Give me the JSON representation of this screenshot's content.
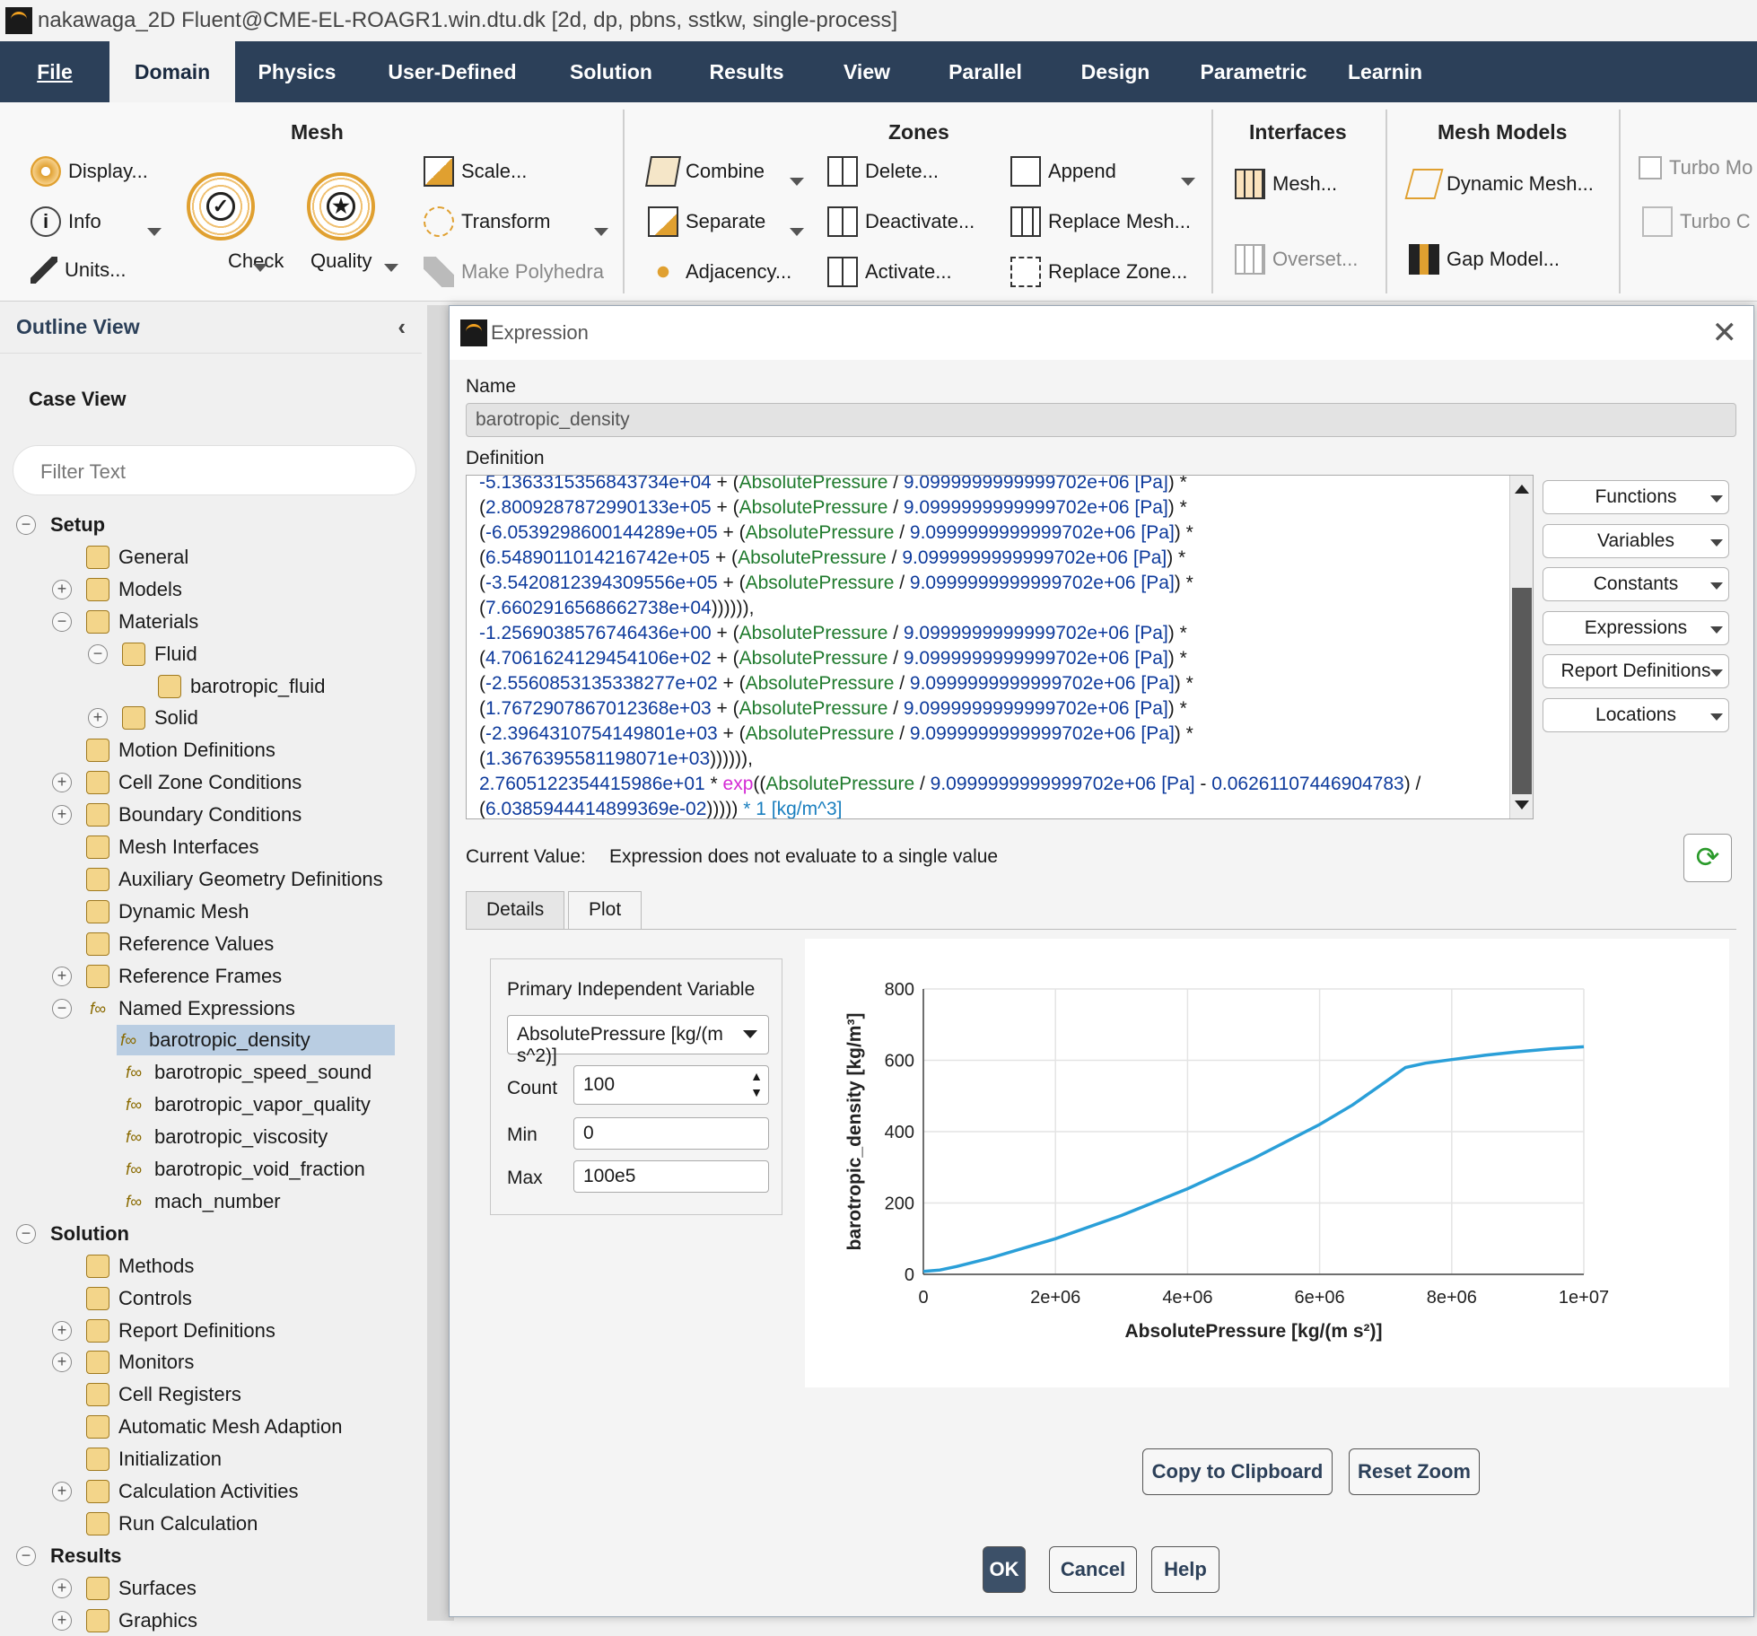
{
  "titlebar": {
    "title": "nakawaga_2D Fluent@CME-EL-ROAGR1.win.dtu.dk  [2d, dp, pbns, sstkw, single-process]"
  },
  "menu": [
    "File",
    "Domain",
    "Physics",
    "User-Defined",
    "Solution",
    "Results",
    "View",
    "Parallel",
    "Design",
    "Parametric",
    "Learnin"
  ],
  "ribbon": {
    "mesh": {
      "title": "Mesh",
      "display": "Display...",
      "info": "Info",
      "units": "Units...",
      "check": "Check",
      "quality": "Quality",
      "scale": "Scale...",
      "transform": "Transform",
      "make_polyhedra": "Make Polyhedra"
    },
    "zones": {
      "title": "Zones",
      "combine": "Combine",
      "separate": "Separate",
      "adjacency": "Adjacency...",
      "delete": "Delete...",
      "deactivate": "Deactivate...",
      "activate": "Activate...",
      "append": "Append",
      "replace_mesh": "Replace Mesh...",
      "replace_zone": "Replace Zone..."
    },
    "interfaces": {
      "title": "Interfaces",
      "mesh": "Mesh...",
      "overset": "Overset..."
    },
    "mesh_models": {
      "title": "Mesh Models",
      "dynamic_mesh": "Dynamic Mesh...",
      "gap_model": "Gap Model..."
    },
    "turbo": {
      "turbo_model": "Turbo Mo",
      "turbo_c": "Turbo C"
    }
  },
  "outline": {
    "title": "Outline View",
    "case_view": "Case View",
    "filter_placeholder": "Filter Text"
  },
  "tree": [
    {
      "label": "Setup",
      "bold": true,
      "pm": "−",
      "indent": 0
    },
    {
      "label": "General",
      "indent": 2
    },
    {
      "label": "Models",
      "pm": "+",
      "indent": 2
    },
    {
      "label": "Materials",
      "pm": "−",
      "indent": 2
    },
    {
      "label": "Fluid",
      "pm": "−",
      "indent": 3
    },
    {
      "label": "barotropic_fluid",
      "indent": 4
    },
    {
      "label": "Solid",
      "pm": "+",
      "indent": 3
    },
    {
      "label": "Motion Definitions",
      "indent": 2
    },
    {
      "label": "Cell Zone Conditions",
      "pm": "+",
      "indent": 2
    },
    {
      "label": "Boundary Conditions",
      "pm": "+",
      "indent": 2
    },
    {
      "label": "Mesh Interfaces",
      "indent": 2
    },
    {
      "label": "Auxiliary Geometry Definitions",
      "indent": 2
    },
    {
      "label": "Dynamic Mesh",
      "indent": 2
    },
    {
      "label": "Reference Values",
      "indent": 2
    },
    {
      "label": "Reference Frames",
      "pm": "+",
      "indent": 2
    },
    {
      "label": "Named Expressions",
      "pm": "−",
      "indent": 2
    },
    {
      "label": "barotropic_density",
      "indent": 3,
      "selected": true
    },
    {
      "label": "barotropic_speed_sound",
      "indent": 3
    },
    {
      "label": "barotropic_vapor_quality",
      "indent": 3
    },
    {
      "label": "barotropic_viscosity",
      "indent": 3
    },
    {
      "label": "barotropic_void_fraction",
      "indent": 3
    },
    {
      "label": "mach_number",
      "indent": 3
    },
    {
      "label": "Solution",
      "bold": true,
      "pm": "−",
      "indent": 0
    },
    {
      "label": "Methods",
      "indent": 2
    },
    {
      "label": "Controls",
      "indent": 2
    },
    {
      "label": "Report Definitions",
      "pm": "+",
      "indent": 2
    },
    {
      "label": "Monitors",
      "pm": "+",
      "indent": 2
    },
    {
      "label": "Cell Registers",
      "indent": 2
    },
    {
      "label": "Automatic Mesh Adaption",
      "indent": 2
    },
    {
      "label": "Initialization",
      "indent": 2
    },
    {
      "label": "Calculation Activities",
      "pm": "+",
      "indent": 2
    },
    {
      "label": "Run Calculation",
      "indent": 2
    },
    {
      "label": "Results",
      "bold": true,
      "pm": "−",
      "indent": 0
    },
    {
      "label": "Surfaces",
      "pm": "+",
      "indent": 2
    },
    {
      "label": "Graphics",
      "pm": "+",
      "indent": 2
    }
  ],
  "dialog": {
    "title": "Expression",
    "name_label": "Name",
    "name_value": "barotropic_density",
    "definition_label": "Definition",
    "definition_lines": [
      [
        [
          "n",
          "-5.1363315356843734e+04"
        ],
        [
          "o",
          " + ("
        ],
        [
          "v",
          "AbsolutePressure"
        ],
        [
          "o",
          " / "
        ],
        [
          "n",
          "9.0999999999999702e+06 [Pa]"
        ],
        [
          "o",
          ") *"
        ]
      ],
      [
        [
          "o",
          "("
        ],
        [
          "n",
          "2.8009287872990133e+05"
        ],
        [
          "o",
          " + ("
        ],
        [
          "v",
          "AbsolutePressure"
        ],
        [
          "o",
          " / "
        ],
        [
          "n",
          "9.0999999999999702e+06 [Pa]"
        ],
        [
          "o",
          ") *"
        ]
      ],
      [
        [
          "o",
          "("
        ],
        [
          "n",
          "-6.0539298600144289e+05"
        ],
        [
          "o",
          " + ("
        ],
        [
          "v",
          "AbsolutePressure"
        ],
        [
          "o",
          " / "
        ],
        [
          "n",
          "9.0999999999999702e+06 [Pa]"
        ],
        [
          "o",
          ") *"
        ]
      ],
      [
        [
          "o",
          "("
        ],
        [
          "n",
          "6.5489011014216742e+05"
        ],
        [
          "o",
          " + ("
        ],
        [
          "v",
          "AbsolutePressure"
        ],
        [
          "o",
          " / "
        ],
        [
          "n",
          "9.0999999999999702e+06 [Pa]"
        ],
        [
          "o",
          ") *"
        ]
      ],
      [
        [
          "o",
          "("
        ],
        [
          "n",
          "-3.5420812394309556e+05"
        ],
        [
          "o",
          " + ("
        ],
        [
          "v",
          "AbsolutePressure"
        ],
        [
          "o",
          " / "
        ],
        [
          "n",
          "9.0999999999999702e+06 [Pa]"
        ],
        [
          "o",
          ") *"
        ]
      ],
      [
        [
          "o",
          "("
        ],
        [
          "n",
          "7.6602916568662738e+04"
        ],
        [
          "o",
          ")))))),"
        ]
      ],
      [
        [
          "n",
          "-1.2569038576746436e+00"
        ],
        [
          "o",
          " + ("
        ],
        [
          "v",
          "AbsolutePressure"
        ],
        [
          "o",
          " / "
        ],
        [
          "n",
          "9.0999999999999702e+06 [Pa]"
        ],
        [
          "o",
          ") *"
        ]
      ],
      [
        [
          "o",
          "("
        ],
        [
          "n",
          "4.7061624129454106e+02"
        ],
        [
          "o",
          " + ("
        ],
        [
          "v",
          "AbsolutePressure"
        ],
        [
          "o",
          " / "
        ],
        [
          "n",
          "9.0999999999999702e+06 [Pa]"
        ],
        [
          "o",
          ") *"
        ]
      ],
      [
        [
          "o",
          "("
        ],
        [
          "n",
          "-2.5560853135338277e+02"
        ],
        [
          "o",
          " + ("
        ],
        [
          "v",
          "AbsolutePressure"
        ],
        [
          "o",
          " / "
        ],
        [
          "n",
          "9.0999999999999702e+06 [Pa]"
        ],
        [
          "o",
          ") *"
        ]
      ],
      [
        [
          "o",
          "("
        ],
        [
          "n",
          "1.7672907867012368e+03"
        ],
        [
          "o",
          " + ("
        ],
        [
          "v",
          "AbsolutePressure"
        ],
        [
          "o",
          " / "
        ],
        [
          "n",
          "9.0999999999999702e+06 [Pa]"
        ],
        [
          "o",
          ") *"
        ]
      ],
      [
        [
          "o",
          "("
        ],
        [
          "n",
          "-2.3964310754149801e+03"
        ],
        [
          "o",
          " + ("
        ],
        [
          "v",
          "AbsolutePressure"
        ],
        [
          "o",
          " / "
        ],
        [
          "n",
          "9.0999999999999702e+06 [Pa]"
        ],
        [
          "o",
          ") *"
        ]
      ],
      [
        [
          "o",
          "("
        ],
        [
          "n",
          "1.3676395581198071e+03"
        ],
        [
          "o",
          ")))))),"
        ]
      ],
      [
        [
          "n",
          "2.7605122354415986e+01"
        ],
        [
          "o",
          " * "
        ],
        [
          "f",
          "exp"
        ],
        [
          "o",
          "(("
        ],
        [
          "v",
          "AbsolutePressure"
        ],
        [
          "o",
          " / "
        ],
        [
          "n",
          "9.0999999999999702e+06 [Pa]"
        ],
        [
          "o",
          " - "
        ],
        [
          "n",
          "0.06261107446904783"
        ],
        [
          "o",
          ") /"
        ]
      ],
      [
        [
          "o",
          "("
        ],
        [
          "n",
          "6.0385944414899369e-02"
        ],
        [
          "o",
          ")))))"
        ],
        [
          "u",
          " * 1 [kg/m^3]"
        ]
      ]
    ],
    "side_buttons": [
      "Functions",
      "Variables",
      "Constants",
      "Expressions",
      "Report Definitions",
      "Locations"
    ],
    "current_value_label": "Current Value:",
    "current_value": "Expression does not evaluate to a single value",
    "tabs": [
      "Details",
      "Plot"
    ],
    "active_tab": "Plot",
    "piv_label": "Primary Independent Variable",
    "piv_value": "AbsolutePressure [kg/(m s^2)]",
    "count_label": "Count",
    "count_value": "100",
    "min_label": "Min",
    "min_value": "0",
    "max_label": "Max",
    "max_value": "100e5",
    "copy_button": "Copy to Clipboard",
    "reset_zoom_button": "Reset Zoom",
    "ok": "OK",
    "cancel": "Cancel",
    "help": "Help"
  },
  "chart_data": {
    "type": "line",
    "xlabel": "AbsolutePressure [kg/(m s²)]",
    "ylabel": "barotropic_density [kg/m³]",
    "xlim": [
      0,
      10000000
    ],
    "ylim": [
      0,
      800
    ],
    "xticks": [
      "0",
      "2e+06",
      "4e+06",
      "6e+06",
      "8e+06",
      "1e+07"
    ],
    "yticks": [
      "0",
      "200",
      "400",
      "600",
      "800"
    ],
    "series": [
      {
        "color": "#2a9fd8",
        "x": [
          0,
          250000,
          500000,
          1000000,
          2000000,
          3000000,
          4000000,
          5000000,
          6000000,
          6500000,
          7000000,
          7300000,
          7600000,
          8000000,
          8500000,
          9000000,
          9500000,
          10000000
        ],
        "y": [
          8,
          12,
          22,
          45,
          100,
          165,
          240,
          325,
          420,
          475,
          540,
          580,
          592,
          602,
          614,
          624,
          632,
          638
        ]
      }
    ],
    "grid": true,
    "colors": {
      "line": "#2a9fd8"
    }
  }
}
